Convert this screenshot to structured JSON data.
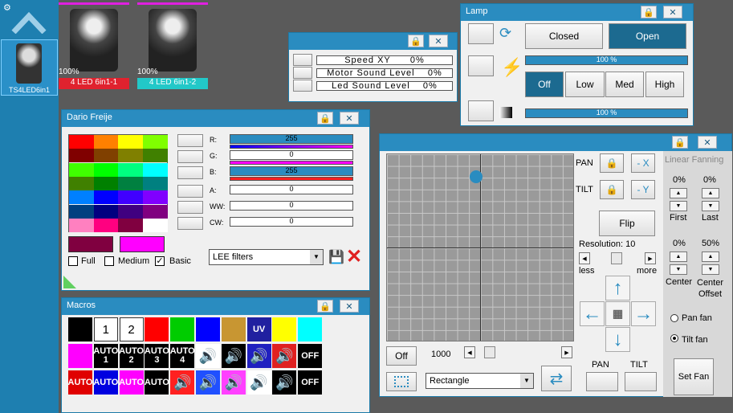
{
  "sidebar": {
    "selected_label": "TS4LED6in1"
  },
  "fixtures": [
    {
      "label": "4 LED 6in1-1",
      "percent": "100%",
      "color": "#e0222e"
    },
    {
      "label": "4 LED 6in1-2",
      "percent": "100%",
      "color": "#22c8c8"
    }
  ],
  "sound_win": {
    "rows": [
      "Speed XY      0%",
      "Motor Sound Level    0%",
      "Led Sound Level    0%"
    ]
  },
  "lamp": {
    "title": "Lamp",
    "closed": "Closed",
    "open": "Open",
    "bar1": "100 %",
    "off": "Off",
    "low": "Low",
    "med": "Med",
    "high": "High",
    "bar2": "100 %"
  },
  "color_win": {
    "title": "Dario Freije",
    "channels": [
      {
        "k": "R:",
        "v": "255"
      },
      {
        "k": "G:",
        "v": "0"
      },
      {
        "k": "B:",
        "v": "255"
      },
      {
        "k": "A:",
        "v": "0"
      },
      {
        "k": "WW:",
        "v": "0"
      },
      {
        "k": "CW:",
        "v": "0"
      }
    ],
    "full": "Full",
    "medium": "Medium",
    "basic": "Basic",
    "filter": "LEE filters",
    "palette": [
      "#ff0000",
      "#ff8000",
      "#ffff00",
      "#80ff00",
      "#800000",
      "#804000",
      "#808000",
      "#408000",
      "#40ff00",
      "#00ff00",
      "#00ff80",
      "#00ffff",
      "#408000",
      "#008000",
      "#008040",
      "#008080",
      "#0080ff",
      "#0000ff",
      "#4000ff",
      "#8000ff",
      "#004080",
      "#000080",
      "#400080",
      "#800080",
      "#ff80c0",
      "#ff0080",
      "#800040",
      "#ffffff"
    ],
    "sel_a": "#800040",
    "sel_b": "#ff00ff"
  },
  "macros": {
    "title": "Macros",
    "row1": [
      "",
      "1",
      "2",
      "",
      "",
      "",
      "",
      "UV",
      "",
      ""
    ],
    "row1c": [
      "#000000",
      "#ffffff",
      "#ffffff",
      "#ff0000",
      "#00cc00",
      "#0000ff",
      "#c89632",
      "#2020a0",
      "#ffff00",
      "#00ffff"
    ],
    "row2": [
      "",
      "AUTO\n1",
      "AUTO\n2",
      "AUTO\n3",
      "AUTO\n4",
      "",
      "",
      "",
      "",
      "OFF"
    ],
    "row2c": [
      "#ff00ff",
      "#000",
      "#000",
      "#000",
      "#000",
      "#fff",
      "#000",
      "#2020c0",
      "#e02020",
      "#000"
    ],
    "row3": [
      "AUTO",
      "AUTO",
      "AUTO",
      "AUTO",
      "",
      "",
      "",
      "",
      "",
      "OFF"
    ],
    "row3c": [
      "#e00000",
      "#0000e0",
      "#ff00ff",
      "#000",
      "#ff2020",
      "#2050ff",
      "#ff40ff",
      "#fff",
      "#000",
      "#000"
    ]
  },
  "pantilt": {
    "pan": "PAN",
    "tilt": "TILT",
    "minus_x": "- X",
    "minus_y": "- Y",
    "flip": "Flip",
    "resolution": "Resolution: 10",
    "less": "less",
    "more": "more",
    "off": "Off",
    "speed": "1000",
    "shape": "Rectangle",
    "pan_btn": "PAN",
    "tilt_btn": "TILT",
    "fan_title": "Linear Fanning",
    "p1": "0%",
    "p2": "0%",
    "first": "First",
    "last": "Last",
    "p3": "0%",
    "p4": "50%",
    "center": "Center",
    "center_offset": "Center\nOffset",
    "pan_fan": "Pan fan",
    "tilt_fan": "Tilt fan",
    "set_fan": "Set Fan"
  }
}
